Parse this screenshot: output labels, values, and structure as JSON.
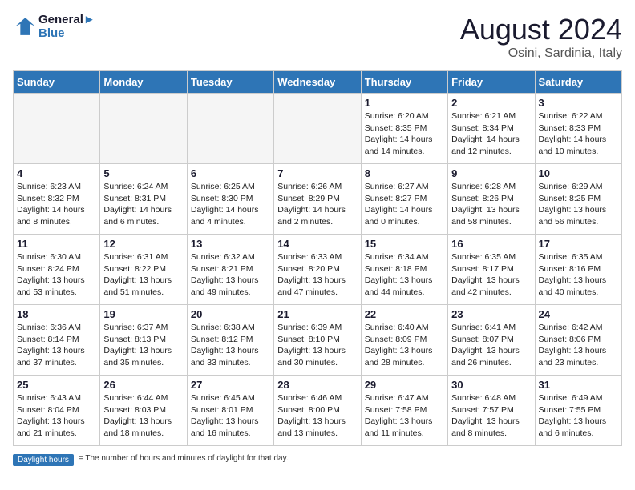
{
  "header": {
    "logo_line1": "General",
    "logo_line2": "Blue",
    "title": "August 2024",
    "subtitle": "Osini, Sardinia, Italy"
  },
  "days_of_week": [
    "Sunday",
    "Monday",
    "Tuesday",
    "Wednesday",
    "Thursday",
    "Friday",
    "Saturday"
  ],
  "note_label": "Daylight hours",
  "weeks": [
    [
      {
        "date": "",
        "sunrise": "",
        "sunset": "",
        "daylight": ""
      },
      {
        "date": "",
        "sunrise": "",
        "sunset": "",
        "daylight": ""
      },
      {
        "date": "",
        "sunrise": "",
        "sunset": "",
        "daylight": ""
      },
      {
        "date": "",
        "sunrise": "",
        "sunset": "",
        "daylight": ""
      },
      {
        "date": "1",
        "sunrise": "Sunrise: 6:20 AM",
        "sunset": "Sunset: 8:35 PM",
        "daylight": "Daylight: 14 hours and 14 minutes."
      },
      {
        "date": "2",
        "sunrise": "Sunrise: 6:21 AM",
        "sunset": "Sunset: 8:34 PM",
        "daylight": "Daylight: 14 hours and 12 minutes."
      },
      {
        "date": "3",
        "sunrise": "Sunrise: 6:22 AM",
        "sunset": "Sunset: 8:33 PM",
        "daylight": "Daylight: 14 hours and 10 minutes."
      }
    ],
    [
      {
        "date": "4",
        "sunrise": "Sunrise: 6:23 AM",
        "sunset": "Sunset: 8:32 PM",
        "daylight": "Daylight: 14 hours and 8 minutes."
      },
      {
        "date": "5",
        "sunrise": "Sunrise: 6:24 AM",
        "sunset": "Sunset: 8:31 PM",
        "daylight": "Daylight: 14 hours and 6 minutes."
      },
      {
        "date": "6",
        "sunrise": "Sunrise: 6:25 AM",
        "sunset": "Sunset: 8:30 PM",
        "daylight": "Daylight: 14 hours and 4 minutes."
      },
      {
        "date": "7",
        "sunrise": "Sunrise: 6:26 AM",
        "sunset": "Sunset: 8:29 PM",
        "daylight": "Daylight: 14 hours and 2 minutes."
      },
      {
        "date": "8",
        "sunrise": "Sunrise: 6:27 AM",
        "sunset": "Sunset: 8:27 PM",
        "daylight": "Daylight: 14 hours and 0 minutes."
      },
      {
        "date": "9",
        "sunrise": "Sunrise: 6:28 AM",
        "sunset": "Sunset: 8:26 PM",
        "daylight": "Daylight: 13 hours and 58 minutes."
      },
      {
        "date": "10",
        "sunrise": "Sunrise: 6:29 AM",
        "sunset": "Sunset: 8:25 PM",
        "daylight": "Daylight: 13 hours and 56 minutes."
      }
    ],
    [
      {
        "date": "11",
        "sunrise": "Sunrise: 6:30 AM",
        "sunset": "Sunset: 8:24 PM",
        "daylight": "Daylight: 13 hours and 53 minutes."
      },
      {
        "date": "12",
        "sunrise": "Sunrise: 6:31 AM",
        "sunset": "Sunset: 8:22 PM",
        "daylight": "Daylight: 13 hours and 51 minutes."
      },
      {
        "date": "13",
        "sunrise": "Sunrise: 6:32 AM",
        "sunset": "Sunset: 8:21 PM",
        "daylight": "Daylight: 13 hours and 49 minutes."
      },
      {
        "date": "14",
        "sunrise": "Sunrise: 6:33 AM",
        "sunset": "Sunset: 8:20 PM",
        "daylight": "Daylight: 13 hours and 47 minutes."
      },
      {
        "date": "15",
        "sunrise": "Sunrise: 6:34 AM",
        "sunset": "Sunset: 8:18 PM",
        "daylight": "Daylight: 13 hours and 44 minutes."
      },
      {
        "date": "16",
        "sunrise": "Sunrise: 6:35 AM",
        "sunset": "Sunset: 8:17 PM",
        "daylight": "Daylight: 13 hours and 42 minutes."
      },
      {
        "date": "17",
        "sunrise": "Sunrise: 6:35 AM",
        "sunset": "Sunset: 8:16 PM",
        "daylight": "Daylight: 13 hours and 40 minutes."
      }
    ],
    [
      {
        "date": "18",
        "sunrise": "Sunrise: 6:36 AM",
        "sunset": "Sunset: 8:14 PM",
        "daylight": "Daylight: 13 hours and 37 minutes."
      },
      {
        "date": "19",
        "sunrise": "Sunrise: 6:37 AM",
        "sunset": "Sunset: 8:13 PM",
        "daylight": "Daylight: 13 hours and 35 minutes."
      },
      {
        "date": "20",
        "sunrise": "Sunrise: 6:38 AM",
        "sunset": "Sunset: 8:12 PM",
        "daylight": "Daylight: 13 hours and 33 minutes."
      },
      {
        "date": "21",
        "sunrise": "Sunrise: 6:39 AM",
        "sunset": "Sunset: 8:10 PM",
        "daylight": "Daylight: 13 hours and 30 minutes."
      },
      {
        "date": "22",
        "sunrise": "Sunrise: 6:40 AM",
        "sunset": "Sunset: 8:09 PM",
        "daylight": "Daylight: 13 hours and 28 minutes."
      },
      {
        "date": "23",
        "sunrise": "Sunrise: 6:41 AM",
        "sunset": "Sunset: 8:07 PM",
        "daylight": "Daylight: 13 hours and 26 minutes."
      },
      {
        "date": "24",
        "sunrise": "Sunrise: 6:42 AM",
        "sunset": "Sunset: 8:06 PM",
        "daylight": "Daylight: 13 hours and 23 minutes."
      }
    ],
    [
      {
        "date": "25",
        "sunrise": "Sunrise: 6:43 AM",
        "sunset": "Sunset: 8:04 PM",
        "daylight": "Daylight: 13 hours and 21 minutes."
      },
      {
        "date": "26",
        "sunrise": "Sunrise: 6:44 AM",
        "sunset": "Sunset: 8:03 PM",
        "daylight": "Daylight: 13 hours and 18 minutes."
      },
      {
        "date": "27",
        "sunrise": "Sunrise: 6:45 AM",
        "sunset": "Sunset: 8:01 PM",
        "daylight": "Daylight: 13 hours and 16 minutes."
      },
      {
        "date": "28",
        "sunrise": "Sunrise: 6:46 AM",
        "sunset": "Sunset: 8:00 PM",
        "daylight": "Daylight: 13 hours and 13 minutes."
      },
      {
        "date": "29",
        "sunrise": "Sunrise: 6:47 AM",
        "sunset": "Sunset: 7:58 PM",
        "daylight": "Daylight: 13 hours and 11 minutes."
      },
      {
        "date": "30",
        "sunrise": "Sunrise: 6:48 AM",
        "sunset": "Sunset: 7:57 PM",
        "daylight": "Daylight: 13 hours and 8 minutes."
      },
      {
        "date": "31",
        "sunrise": "Sunrise: 6:49 AM",
        "sunset": "Sunset: 7:55 PM",
        "daylight": "Daylight: 13 hours and 6 minutes."
      }
    ]
  ]
}
